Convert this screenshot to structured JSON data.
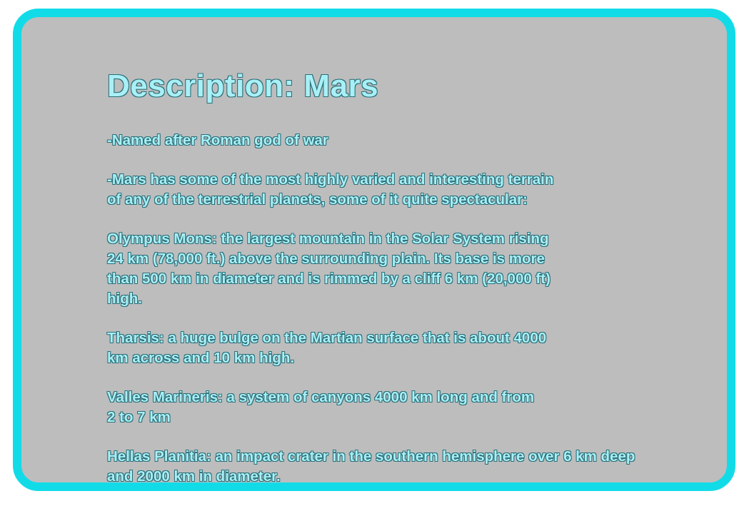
{
  "panel": {
    "title": "Description: Mars",
    "paragraphs": [
      "-Named after Roman god of war",
      "-Mars has some of the most highly varied and interesting terrain\nof any of the terrestrial planets, some of it quite spectacular:",
      "Olympus Mons: the largest mountain in the Solar System rising\n24 km (78,000 ft.) above the surrounding plain. Its base is more\nthan 500 km in diameter and is rimmed by a cliff 6 km (20,000 ft)\nhigh.",
      "Tharsis: a huge bulge on the Martian surface that is about 4000\nkm across and 10 km high.",
      "Valles Marineris: a system of canyons 4000 km long and from\n2 to 7 km",
      "Hellas Planitia: an impact crater in the southern hemisphere over 6 km deep\nand 2000 km in diameter."
    ]
  },
  "colors": {
    "border": "#12dbe8",
    "background": "#bdbdbd",
    "text": "#a9f0f6"
  }
}
